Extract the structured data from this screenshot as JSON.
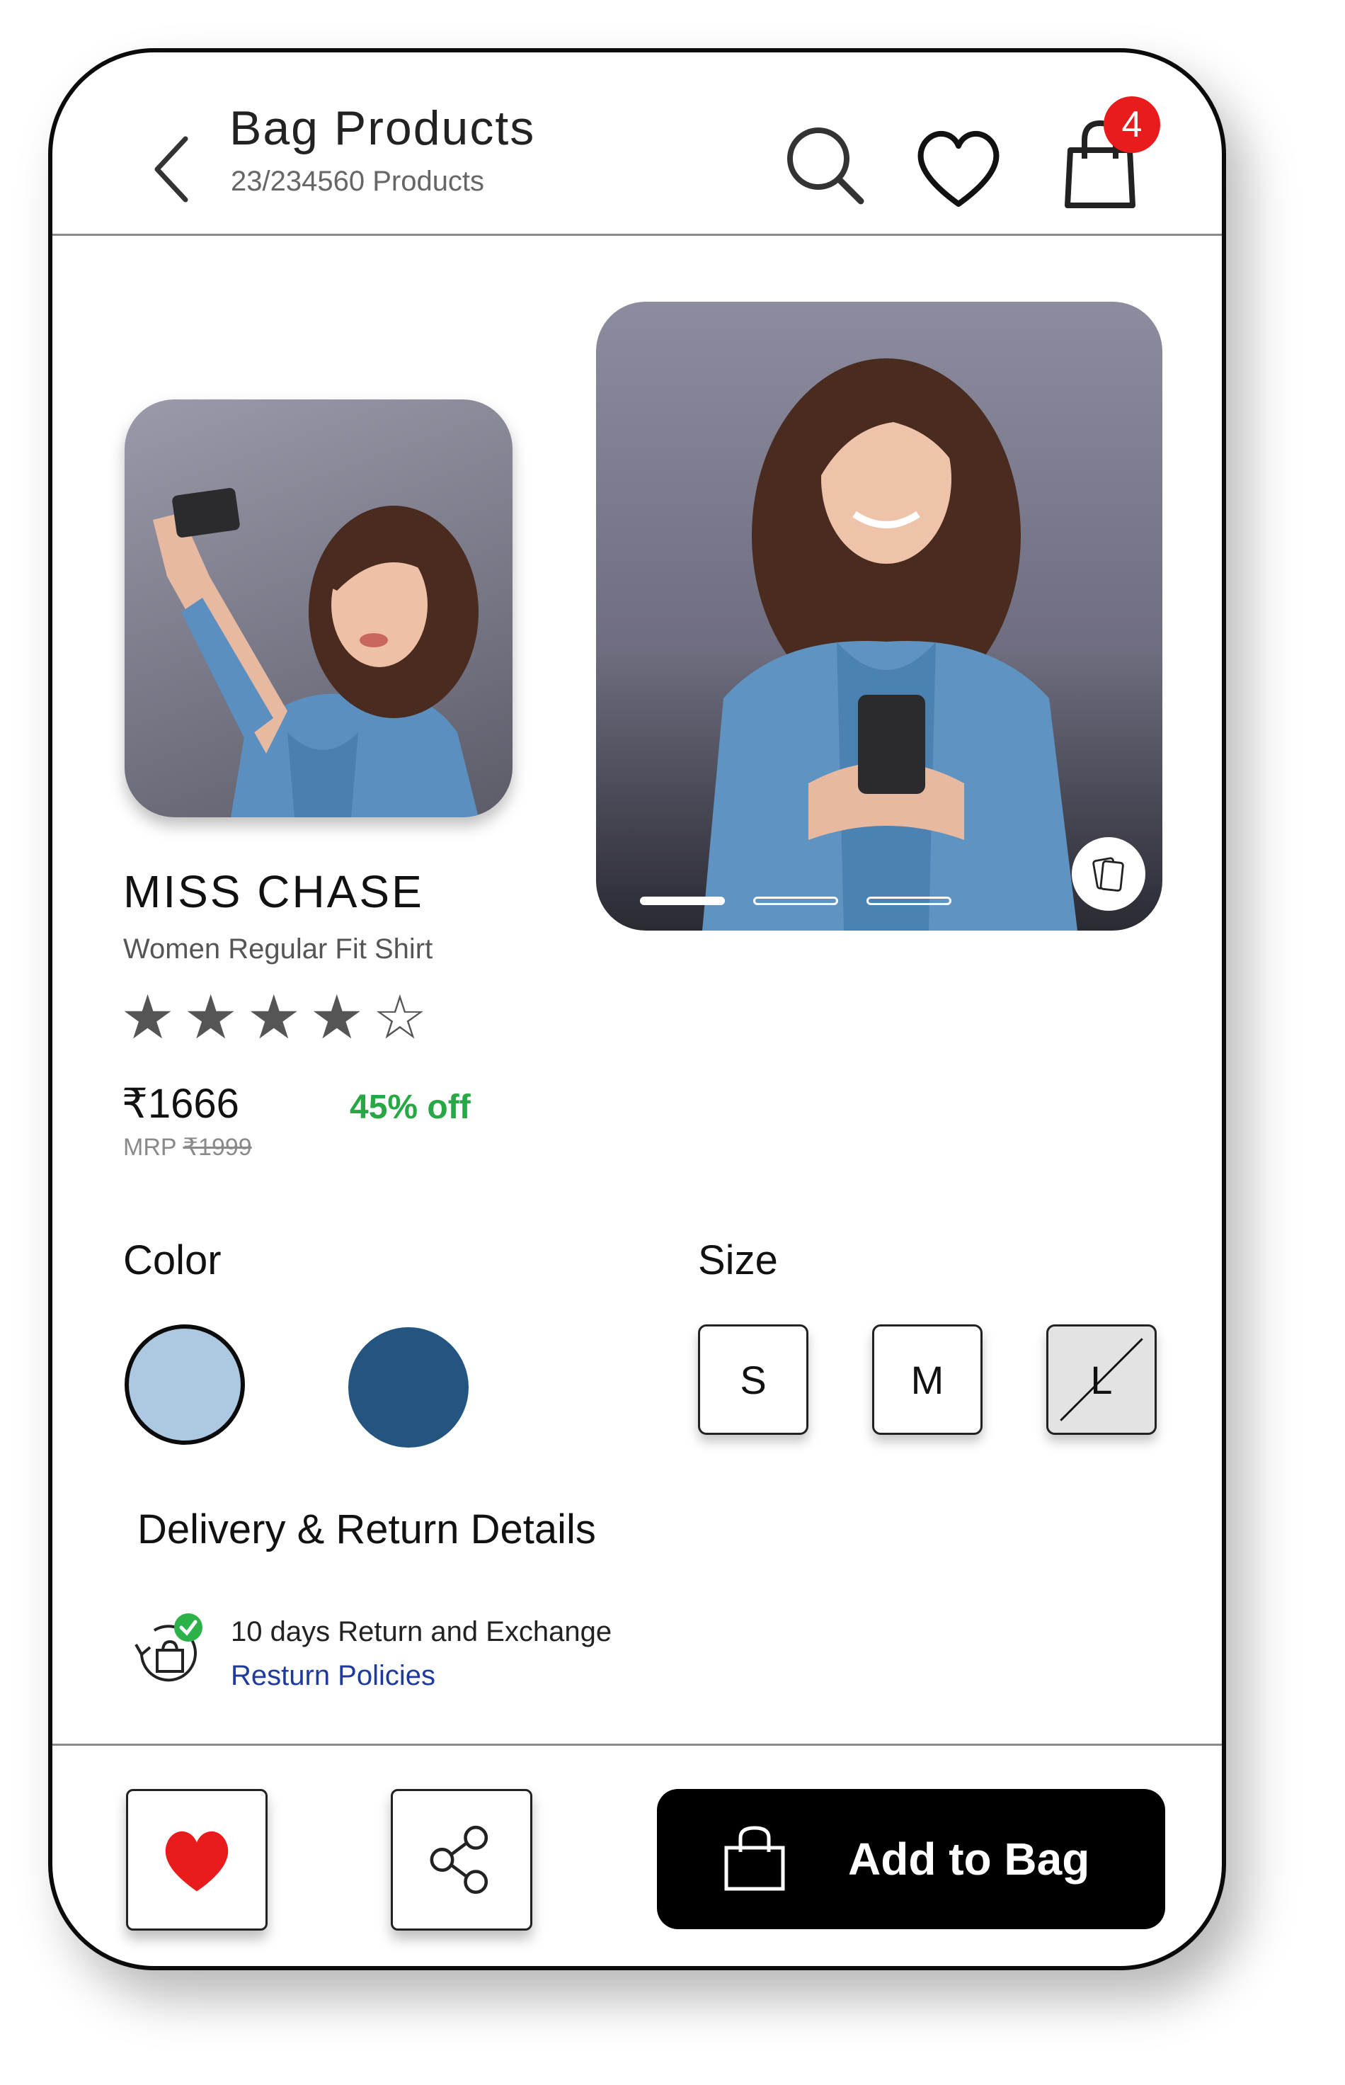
{
  "header": {
    "title": "Bag Products",
    "subtitle": "23/234560 Products",
    "cart_count": "4"
  },
  "gallery": {
    "active_index": 0,
    "total": 3
  },
  "product": {
    "brand": "MISS CHASE",
    "name": "Women Regular Fit Shirt",
    "rating_filled": 4,
    "rating_max": 5,
    "stars_text": "★★★★☆",
    "price": "₹1666",
    "mrp_label": "MRP",
    "mrp_value": "₹1999",
    "discount": "45% off"
  },
  "color": {
    "label": "Color",
    "swatches": [
      "#adc9e2",
      "#235580"
    ],
    "selected_index": 0
  },
  "size": {
    "label": "Size",
    "options": [
      "S",
      "M",
      "L"
    ],
    "unavailable": [
      "L"
    ]
  },
  "delivery": {
    "title": "Delivery & Return Details",
    "return_text": "10 days Return and Exchange",
    "policy_link": "Resturn Policies"
  },
  "actions": {
    "add_to_bag": "Add to Bag"
  },
  "colors": {
    "accent_black": "#000000",
    "badge_red": "#e81c1c",
    "discount_green": "#28a745",
    "link_blue": "#1e3a9c",
    "heart_red": "#e81c1c"
  }
}
